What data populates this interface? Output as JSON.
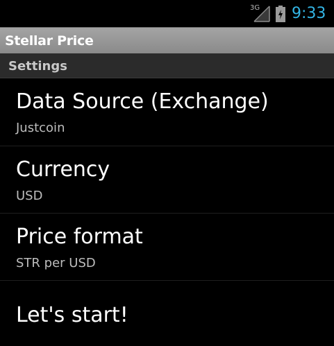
{
  "status_bar": {
    "network_label": "3G",
    "time": "9:33",
    "time_color": "#33b5e5",
    "icons": [
      "signal-icon",
      "battery-charging-icon"
    ]
  },
  "action_bar": {
    "title": "Stellar Price"
  },
  "settings": {
    "category_title": "Settings",
    "items": [
      {
        "title": "Data Source (Exchange)",
        "summary": "Justcoin"
      },
      {
        "title": "Currency",
        "summary": "USD"
      },
      {
        "title": "Price format",
        "summary": "STR per USD"
      },
      {
        "title": "Let's start!"
      }
    ]
  }
}
